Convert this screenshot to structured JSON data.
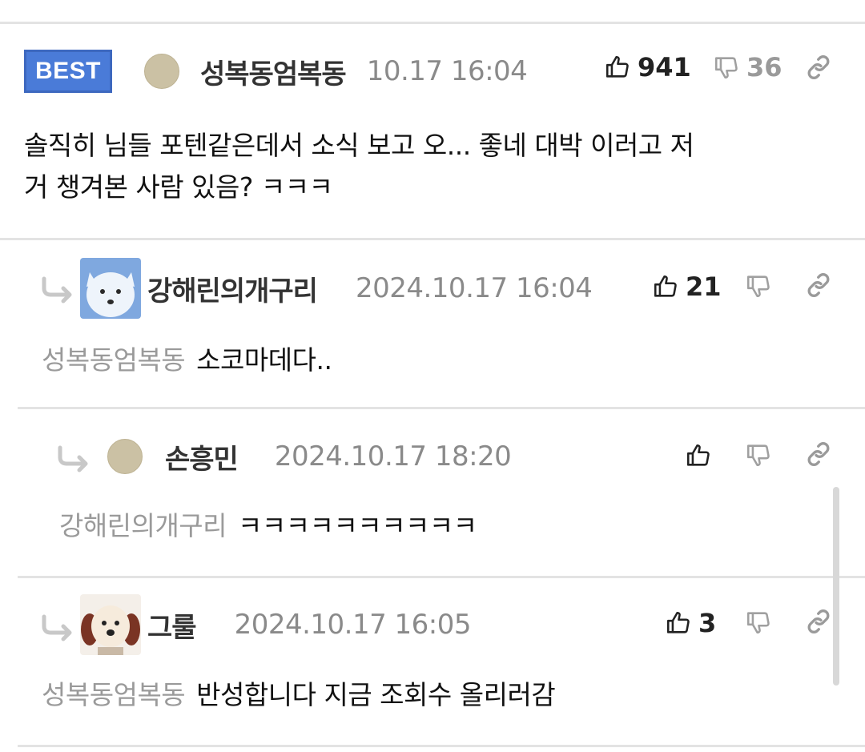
{
  "best": {
    "badge": "BEST",
    "nickname": "성복동엄복동",
    "date": "10.17 16:04",
    "likes": "941",
    "dislikes": "36",
    "text_line1": "솔직히 님들 포텐같은데서 소식 보고 오... 좋네 대박 이러고 저",
    "text_line2": "거 챙겨본 사람 있음? ㅋㅋㅋ"
  },
  "replies": [
    {
      "nickname": "강해린의개구리",
      "date": "2024.10.17 16:04",
      "likes": "21",
      "mention": "성복동엄복동",
      "text": "소코마데다.."
    },
    {
      "nickname": "손흥민",
      "date": "2024.10.17 18:20",
      "likes": "",
      "mention": "강해린의개구리",
      "text": "ㅋㅋㅋㅋㅋㅋㅋㅋㅋㅋ"
    },
    {
      "nickname": "그룰",
      "date": "2024.10.17 16:05",
      "likes": "3",
      "mention": "성복동엄복동",
      "text": "반성합니다 지금 조회수 올리러감"
    }
  ],
  "colors": {
    "badge": "#4a7bd8",
    "mention": "#9a9a9a",
    "date": "#8a8a8a"
  },
  "icons": [
    "thumbs-up-icon",
    "thumbs-down-icon",
    "link-icon",
    "reply-arrow-icon"
  ]
}
